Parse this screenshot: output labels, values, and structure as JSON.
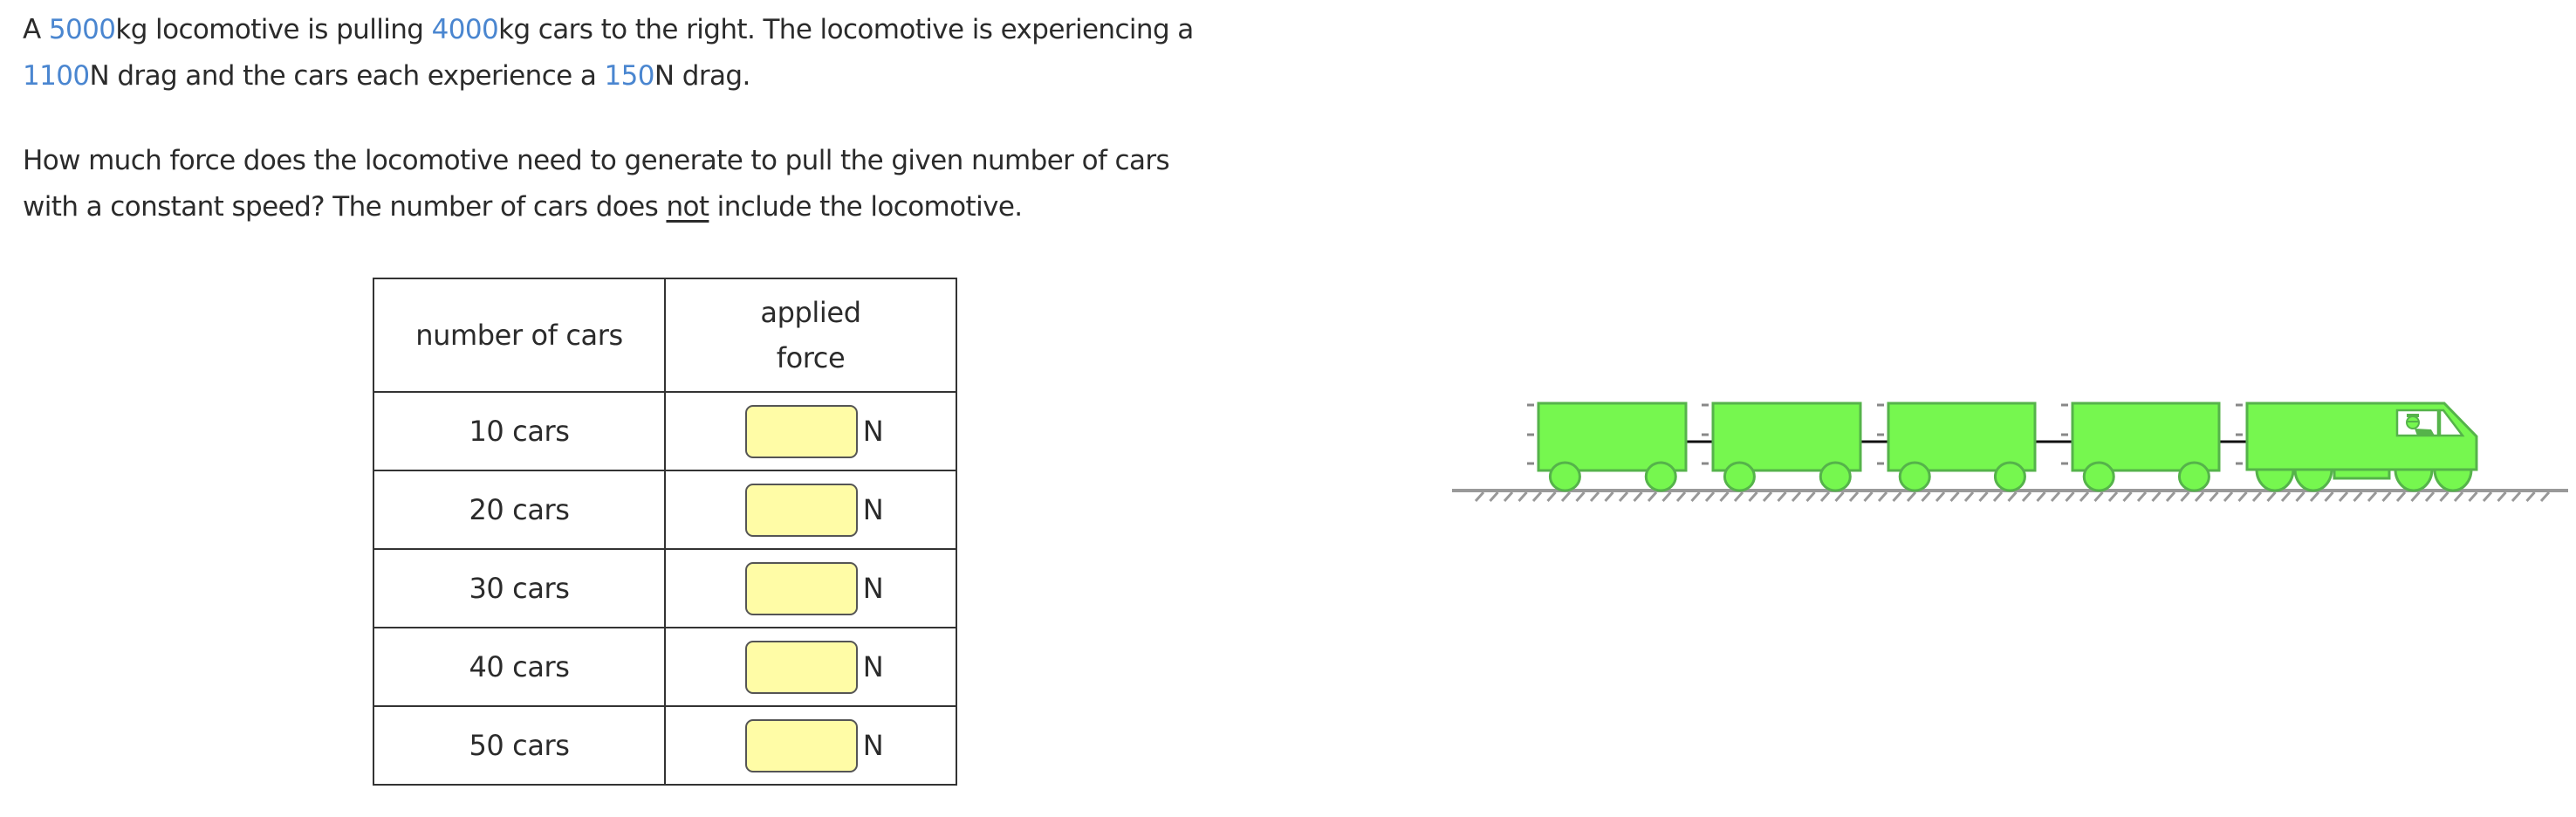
{
  "problem": {
    "paragraph1": {
      "t0": "A ",
      "loco_mass": "5000",
      "t1": "kg locomotive is pulling ",
      "car_mass": "4000",
      "t2": "kg cars to the right. The locomotive is experiencing a",
      "loco_drag": "1100",
      "t3": "N drag and the cars each experience a ",
      "car_drag": "150",
      "t4": "N drag."
    },
    "paragraph2": {
      "line1": "How much force does the locomotive need to generate to pull the given number of cars",
      "t0": "with a constant speed? The number of cars does ",
      "emphasis": "not",
      "t1": " include the locomotive."
    },
    "value_color": "#4a86d0"
  },
  "table": {
    "headers": {
      "col1": "number of cars",
      "col2_line1": "applied",
      "col2_line2": "force"
    },
    "rows": [
      {
        "label": "10 cars",
        "value": "",
        "unit": "N"
      },
      {
        "label": "20 cars",
        "value": "",
        "unit": "N"
      },
      {
        "label": "30 cars",
        "value": "",
        "unit": "N"
      },
      {
        "label": "40 cars",
        "value": "",
        "unit": "N"
      },
      {
        "label": "50 cars",
        "value": "",
        "unit": "N"
      }
    ],
    "input_color": "#fffca6"
  },
  "illustration": {
    "cars_shown": 4,
    "has_locomotive": true,
    "direction": "right",
    "fill_color": "#76f74f",
    "stroke_color": "#55b34a",
    "ground_color": "#999999"
  }
}
